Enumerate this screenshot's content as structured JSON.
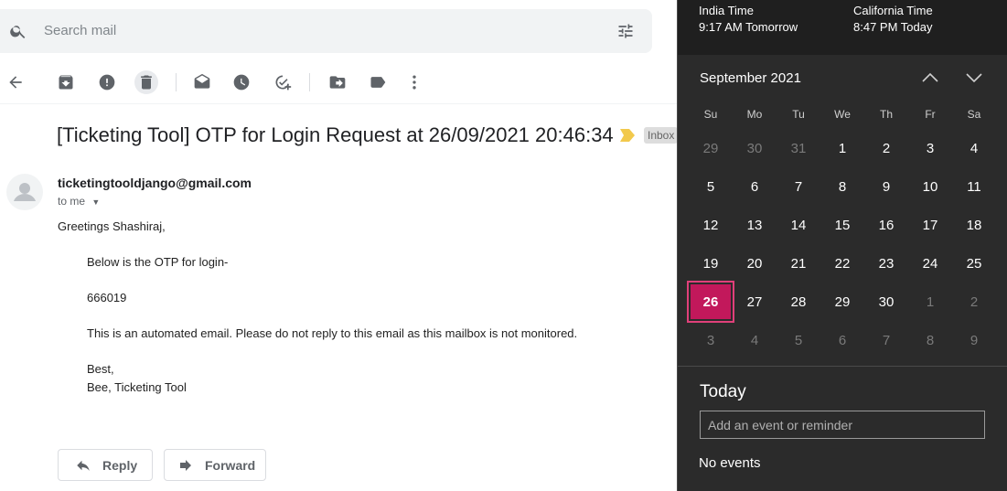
{
  "search": {
    "placeholder": "Search mail"
  },
  "email": {
    "subject": "[Ticketing Tool] OTP for Login Request at 26/09/2021 20:46:34",
    "label": "Inbox",
    "sender": "ticketingtooldjango@gmail.com",
    "to": "to me",
    "greeting": "Greetings Shashiraj,",
    "line1": "Below is the OTP for login-",
    "otp": "666019",
    "line2": "This is an automated email. Please do not reply to this email as this mailbox is not monitored.",
    "signoff": "Best,",
    "signature": "Bee, Ticketing Tool",
    "reply_label": "Reply",
    "forward_label": "Forward"
  },
  "clocks": [
    {
      "name": "India Time",
      "time": "9:17 AM Tomorrow"
    },
    {
      "name": "California Time",
      "time": "8:47 PM Today"
    }
  ],
  "calendar": {
    "month": "September 2021",
    "weekdays": [
      "Su",
      "Mo",
      "Tu",
      "We",
      "Th",
      "Fr",
      "Sa"
    ],
    "weeks": [
      [
        "29",
        "30",
        "31",
        "1",
        "2",
        "3",
        "4"
      ],
      [
        "5",
        "6",
        "7",
        "8",
        "9",
        "10",
        "11"
      ],
      [
        "12",
        "13",
        "14",
        "15",
        "16",
        "17",
        "18"
      ],
      [
        "19",
        "20",
        "21",
        "22",
        "23",
        "24",
        "25"
      ],
      [
        "26",
        "27",
        "28",
        "29",
        "30",
        "1",
        "2"
      ],
      [
        "3",
        "4",
        "5",
        "6",
        "7",
        "8",
        "9"
      ]
    ],
    "selected": "26"
  },
  "agenda": {
    "title": "Today",
    "input_placeholder": "Add an event or reminder",
    "empty": "No events"
  }
}
